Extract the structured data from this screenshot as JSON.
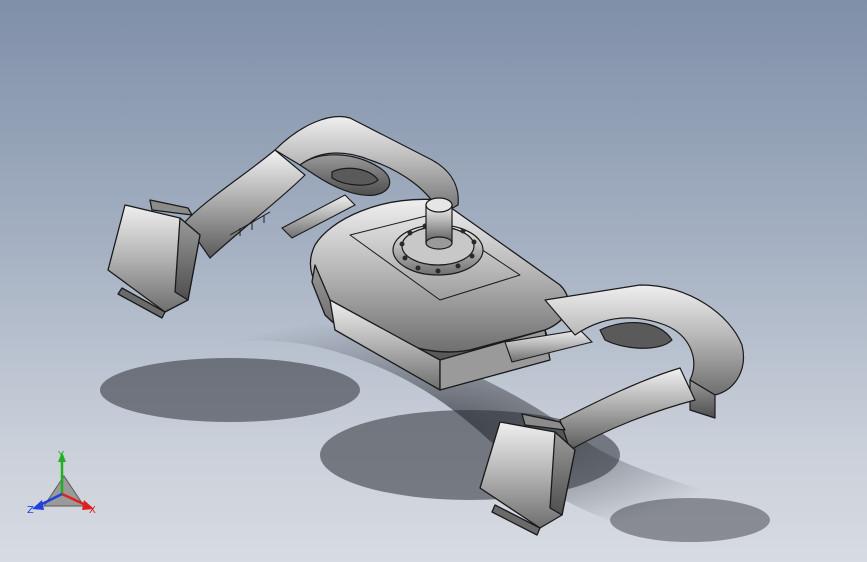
{
  "viewport": {
    "background_top": "#7f8fa8",
    "background_bottom": "#d7dbe2",
    "model_color": "#b9b9b9",
    "edge_color": "#1a1a1a",
    "shadow_color": "#2c2f36"
  },
  "triad": {
    "x_label": "X",
    "y_label": "Y",
    "z_label": "Z",
    "x_color": "#e02020",
    "y_color": "#20b020",
    "z_color": "#2040e0"
  }
}
